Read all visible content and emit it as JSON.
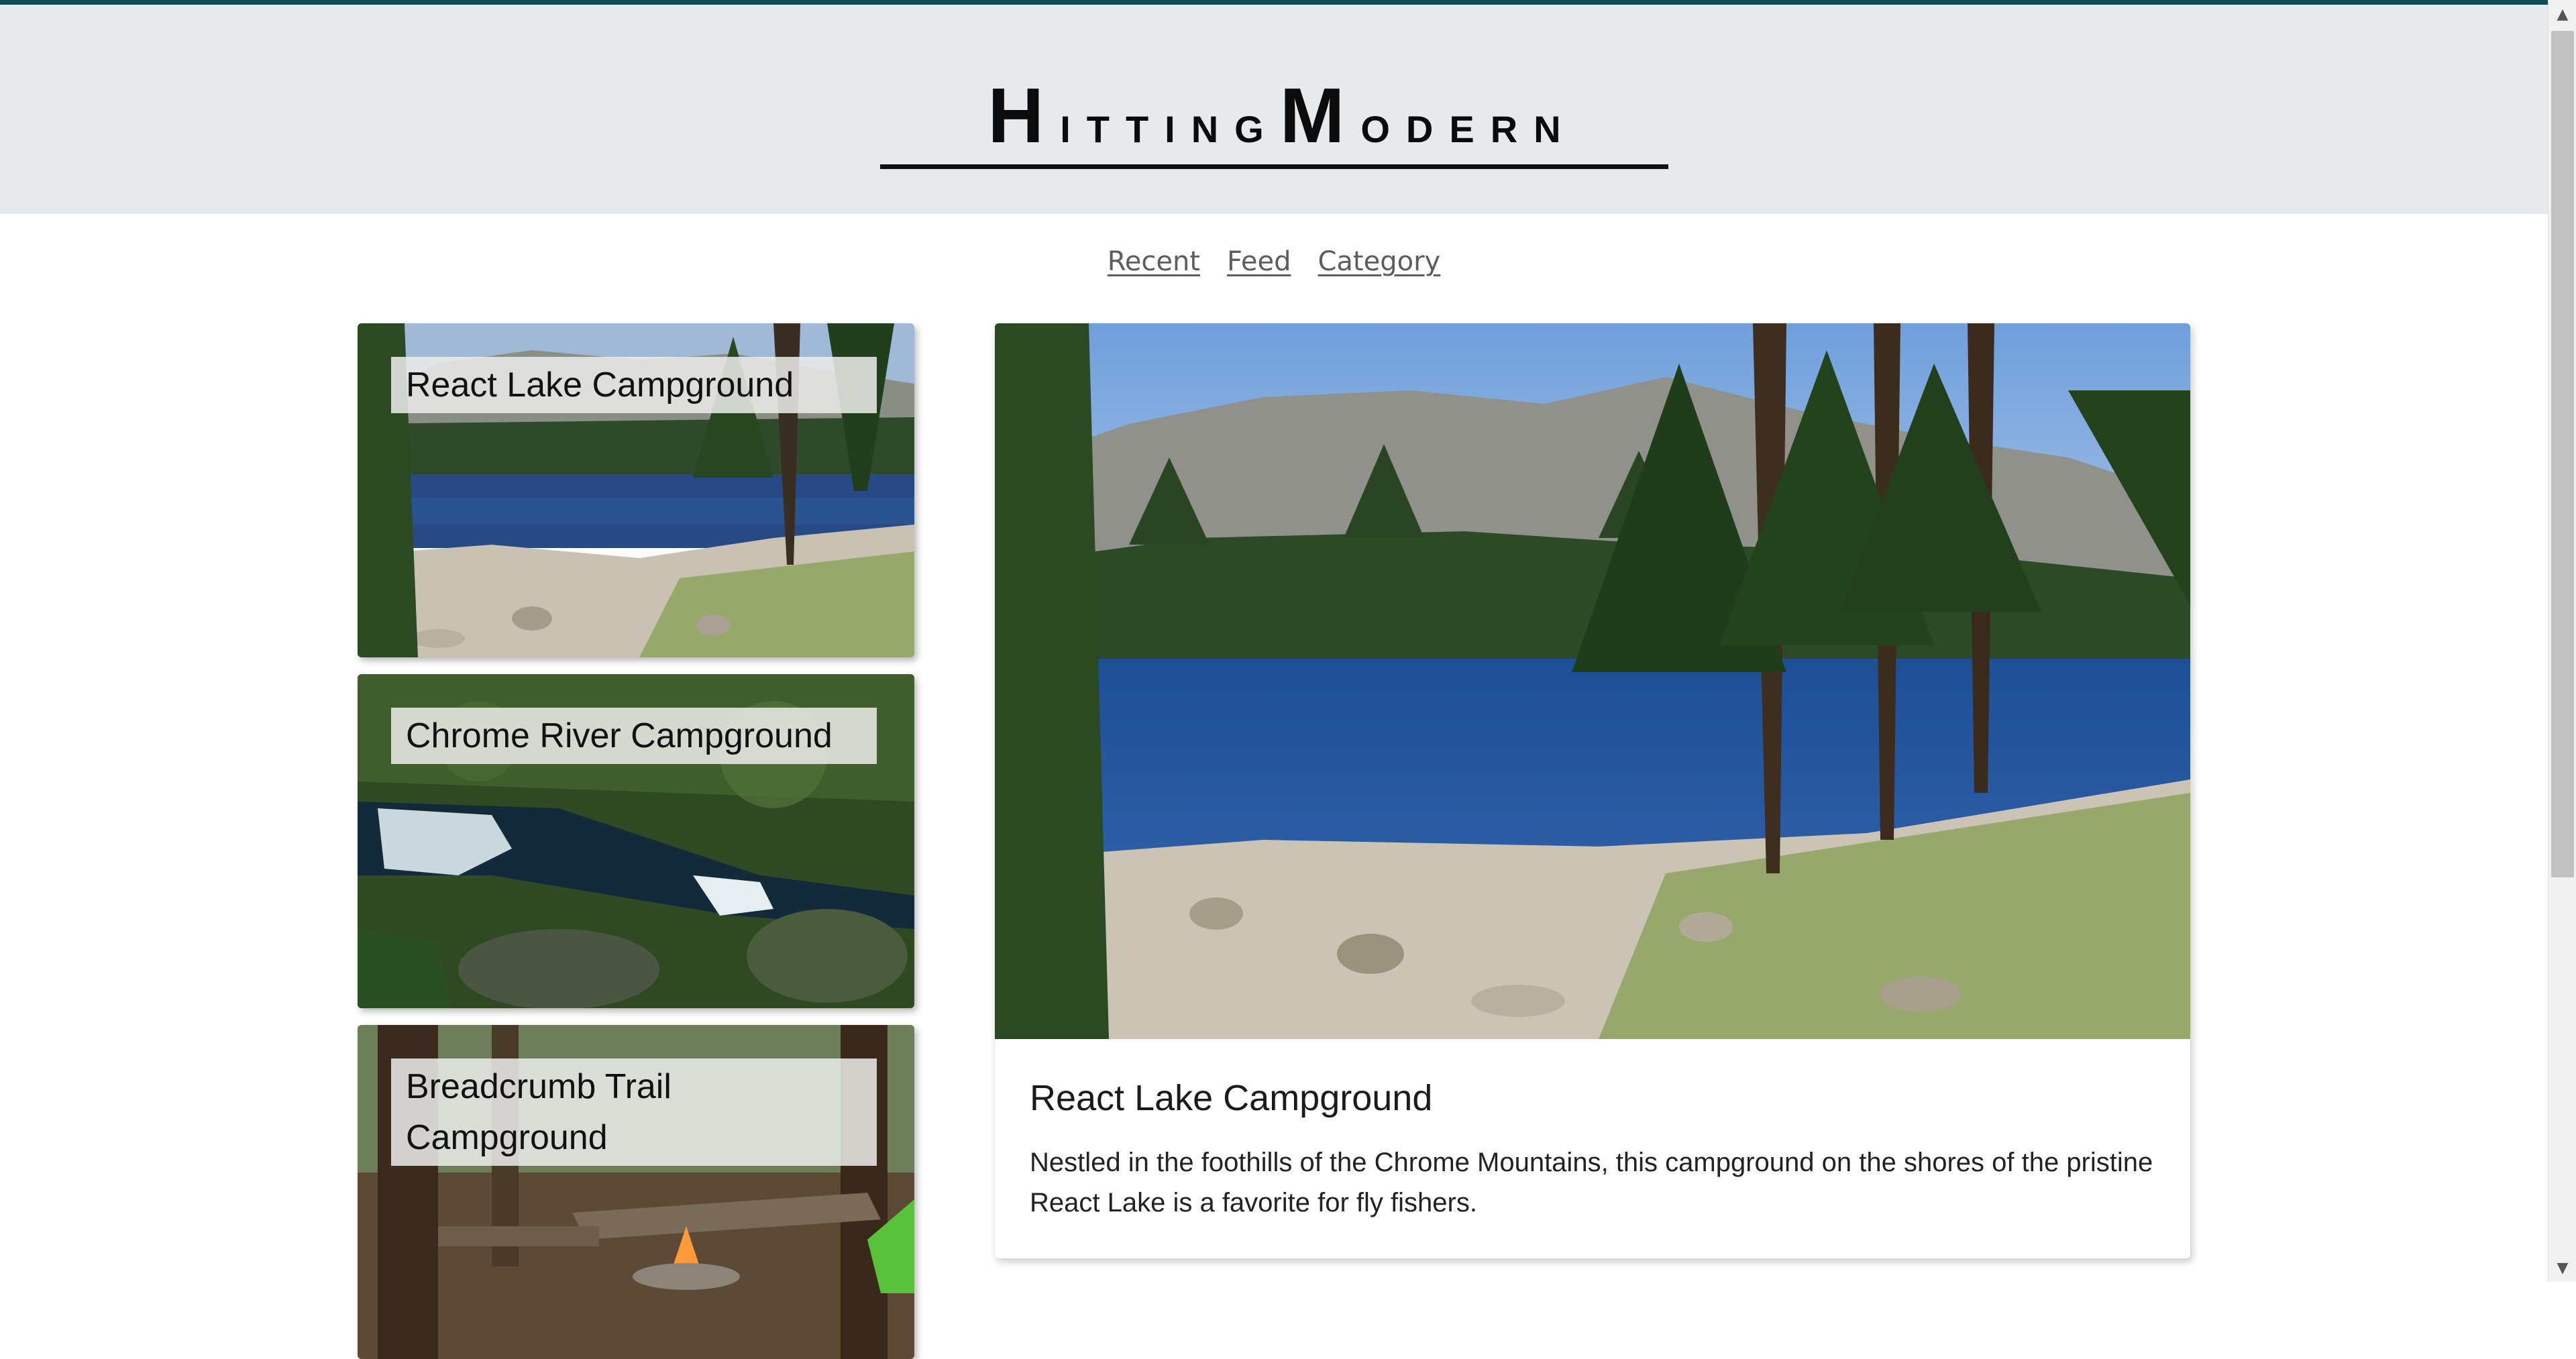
{
  "brand": {
    "part1_initial": "H",
    "part1_rest": "itting",
    "part2_initial": "M",
    "part2_rest": "odern"
  },
  "nav": {
    "items": [
      "Recent",
      "Feed",
      "Category"
    ]
  },
  "cards": [
    {
      "title": "React Lake Campground"
    },
    {
      "title": "Chrome River Campground"
    },
    {
      "title": "Breadcrumb Trail Campground"
    }
  ],
  "feature": {
    "title": "React Lake Campground",
    "description": "Nestled in the foothills of the Chrome Mountains, this campground on the shores of the pristine React Lake is a favorite for fly fishers."
  },
  "colors": {
    "accent": "#0e4f55",
    "header_bg": "#e7eaed",
    "nav_link": "#5d5d5d"
  },
  "icons": {
    "scroll_up": "triangle-up-icon",
    "scroll_down": "triangle-down-icon"
  }
}
